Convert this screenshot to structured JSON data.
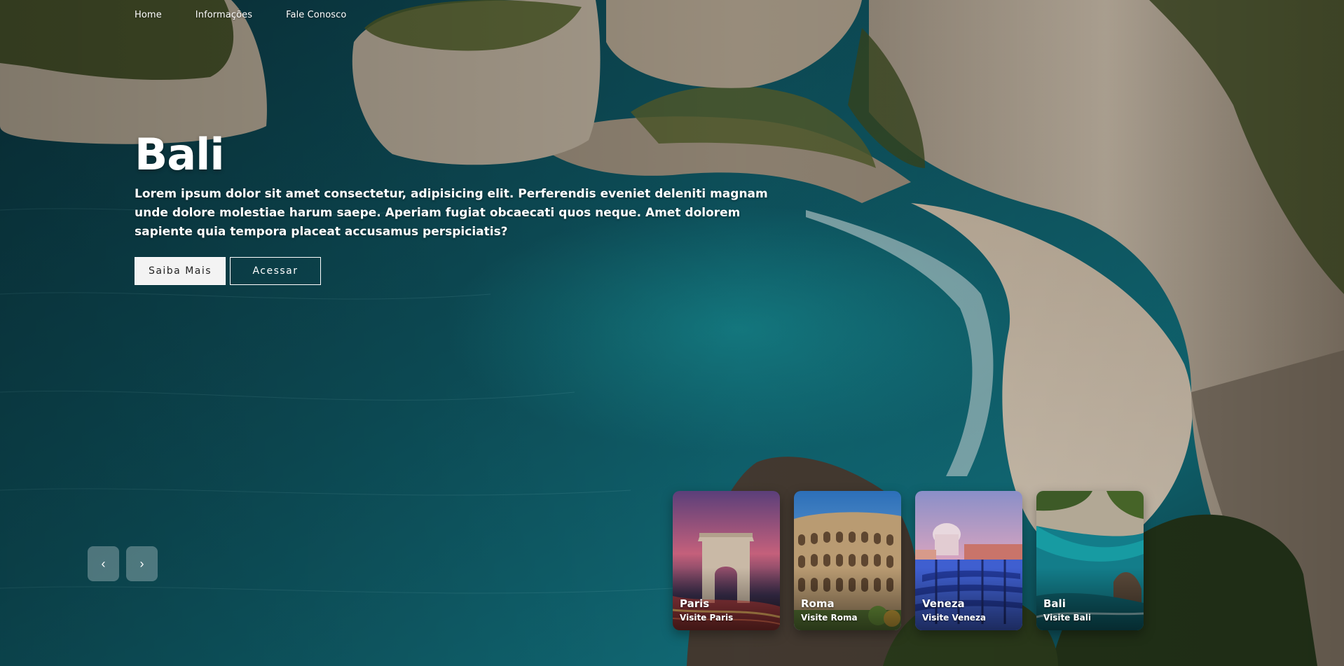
{
  "nav": {
    "items": [
      {
        "label": "Home"
      },
      {
        "label": "Informações"
      },
      {
        "label": "Fale Conosco"
      }
    ]
  },
  "hero": {
    "title": "Bali",
    "description": "Lorem ipsum dolor sit amet consectetur, adipisicing elit. Perferendis eveniet deleniti magnam unde dolore molestiae harum saepe. Aperiam fugiat obcaecati quos neque. Amet dolorem sapiente quia tempora placeat accusamus perspiciatis?",
    "primary_button": "Saiba Mais",
    "secondary_button": "Acessar"
  },
  "slider": {
    "prev_icon": "chevron-left-icon",
    "next_icon": "chevron-right-icon",
    "prev_glyph": "‹",
    "next_glyph": "›"
  },
  "cards": [
    {
      "name": "Paris",
      "subtitle": "Visite Paris"
    },
    {
      "name": "Roma",
      "subtitle": "Visite Roma"
    },
    {
      "name": "Veneza",
      "subtitle": "Visite Veneza"
    },
    {
      "name": "Bali",
      "subtitle": "Visite Bali"
    }
  ],
  "colors": {
    "sea": "#0f5a66",
    "sea_deep": "#0a3640",
    "cliff": "#bfb3a3",
    "sand": "#d9cbb8",
    "foliage": "#3e4a22"
  }
}
